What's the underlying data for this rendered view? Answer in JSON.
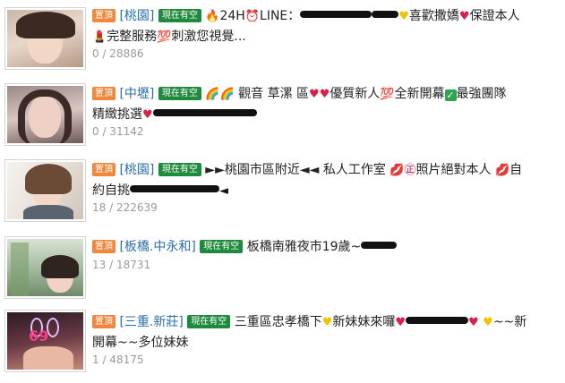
{
  "tag_top_label": "置頂",
  "tag_available_label": "現在有空",
  "posts": [
    {
      "region": "[桃園]",
      "line1_a": "24H",
      "line1_b": "LINE：",
      "line1_c": "喜歡撒嬌",
      "line1_d": "保證本人",
      "line2_a": "完整服務",
      "line2_b": "刺激您視覺...",
      "stats": "0 / 28886"
    },
    {
      "region": "[中壢]",
      "line1_a": "觀音 草漯 區",
      "line1_b": "優質新人",
      "line1_c": "全新開幕",
      "line1_d": "最強團隊",
      "line2_a": "精緻挑選",
      "stats": "0 / 31142"
    },
    {
      "region": "[桃園]",
      "line1_a": "►►桃園市區附近◄◄ 私人工作室",
      "line1_b": "照片絕對本人",
      "line1_c": "自",
      "line2_a": "約自挑",
      "stats": "18 / 222639"
    },
    {
      "region": "[板橋.中永和]",
      "line1_a": "板橋南雅夜市19歲~",
      "stats": "13 / 18731"
    },
    {
      "region": "[三重.新莊]",
      "line1_a": "三重區忠孝橋下",
      "line1_b": "新妹妹來囉",
      "line1_c": "~~新",
      "line2_a": "開幕~~多位妹妹",
      "stats": "1 / 48175"
    }
  ]
}
